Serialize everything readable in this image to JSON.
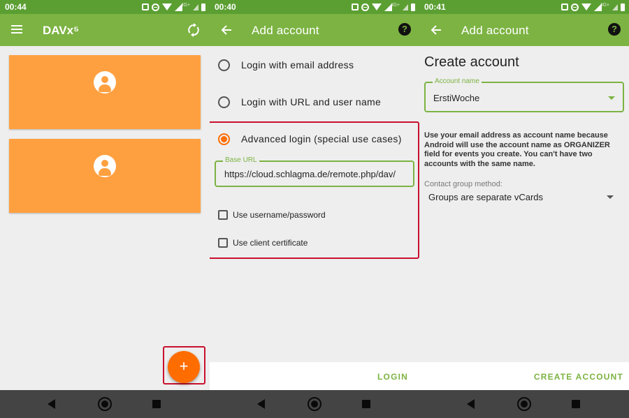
{
  "screens": [
    {
      "status": {
        "time": "00:44",
        "network": "4G+"
      },
      "appbar": {
        "title": "DAVx⁵",
        "menu_icon": "hamburger-menu-icon",
        "action_icon": "sync-icon"
      },
      "accounts": [
        {
          "avatar_icon": "account-circle-icon"
        },
        {
          "avatar_icon": "account-circle-icon"
        }
      ],
      "fab": {
        "label": "+"
      },
      "nav": {
        "back_icon": "nav-back-icon",
        "home_icon": "nav-home-icon",
        "recents_icon": "nav-recents-icon"
      }
    },
    {
      "status": {
        "time": "00:40",
        "network": "4G+"
      },
      "appbar": {
        "title": "Add account",
        "help": "?"
      },
      "options": [
        {
          "label": "Login with email address",
          "selected": false
        },
        {
          "label": "Login with URL and user name",
          "selected": false
        },
        {
          "label": "Advanced login (special use cases)",
          "selected": true
        }
      ],
      "base_url": {
        "label": "Base URL",
        "value": "https://cloud.schlagma.de/remote.php/dav/"
      },
      "checkboxes": [
        {
          "label": "Use username/password",
          "checked": false
        },
        {
          "label": "Use client certificate",
          "checked": false
        }
      ],
      "action": "LOGIN"
    },
    {
      "status": {
        "time": "00:41",
        "network": "4G+"
      },
      "appbar": {
        "title": "Add account",
        "help": "?"
      },
      "heading": "Create account",
      "account_name": {
        "label": "Account name",
        "value": "ErstiWoche"
      },
      "info": "Use your email address as account name because Android will use the account name as ORGANIZER field for events you create. You can't have two accounts with the same name.",
      "contact_group": {
        "label": "Contact group method:",
        "value": "Groups are separate vCards"
      },
      "action": "CREATE ACCOUNT"
    }
  ],
  "colors": {
    "appbar": "#7cb342",
    "statusbar": "#5b9f32",
    "accent": "#ff6d00",
    "card": "#ffa040",
    "highlight": "#c8102e"
  }
}
